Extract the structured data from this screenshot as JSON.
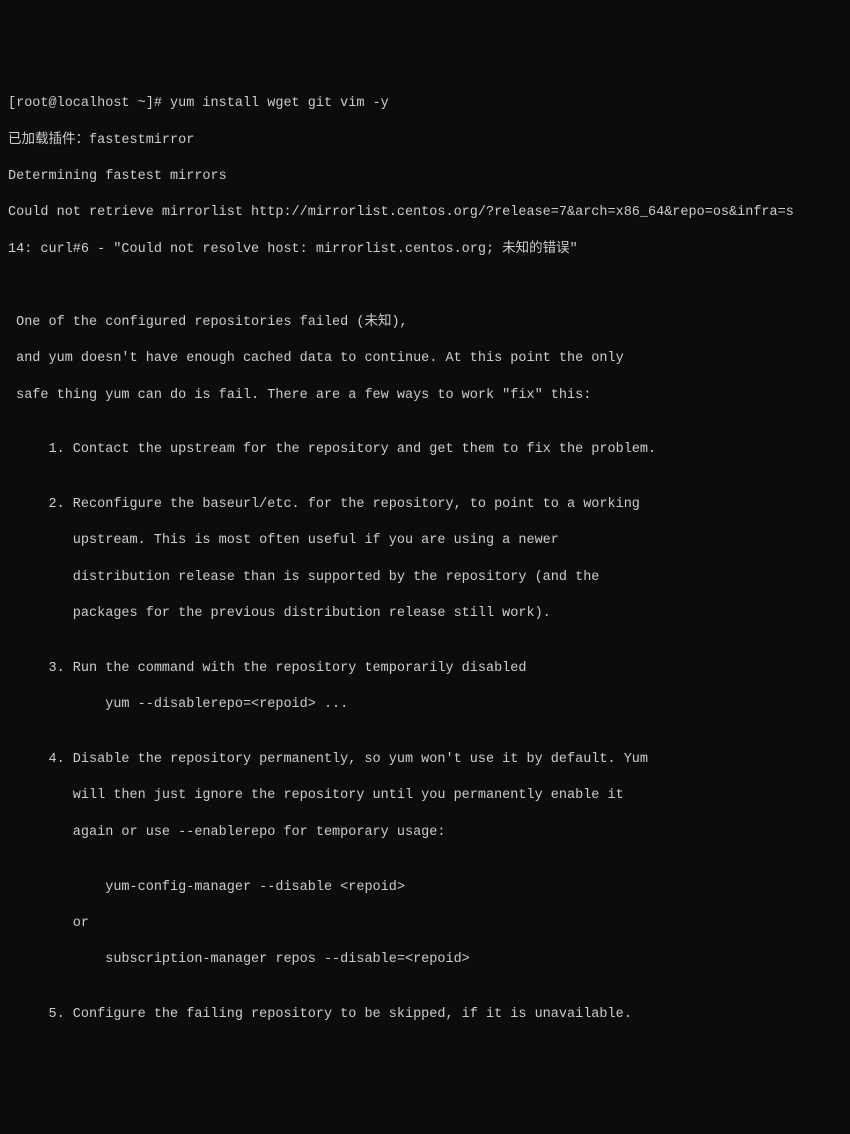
{
  "terminal": {
    "prompt": "[root@localhost ~]# ",
    "command": "yum install wget git vim -y",
    "output": {
      "line1": "已加载插件：fastestmirror",
      "line2": "Determining fastest mirrors",
      "line3": "Could not retrieve mirrorlist http://mirrorlist.centos.org/?release=7&arch=x86_64&repo=os&infra=s",
      "line4": "14: curl#6 - \"Could not resolve host: mirrorlist.centos.org; 未知的错误\"",
      "blank1": "",
      "blank2": "",
      "msg1": " One of the configured repositories failed (未知),",
      "msg2": " and yum doesn't have enough cached data to continue. At this point the only",
      "msg3": " safe thing yum can do is fail. There are a few ways to work \"fix\" this:",
      "blank3": "",
      "item1": "     1. Contact the upstream for the repository and get them to fix the problem.",
      "blank4": "",
      "item2a": "     2. Reconfigure the baseurl/etc. for the repository, to point to a working",
      "item2b": "        upstream. This is most often useful if you are using a newer",
      "item2c": "        distribution release than is supported by the repository (and the",
      "item2d": "        packages for the previous distribution release still work).",
      "blank5": "",
      "item3a": "     3. Run the command with the repository temporarily disabled",
      "item3b": "            yum --disablerepo=<repoid> ...",
      "blank6": "",
      "item4a": "     4. Disable the repository permanently, so yum won't use it by default. Yum",
      "item4b": "        will then just ignore the repository until you permanently enable it",
      "item4c": "        again or use --enablerepo for temporary usage:",
      "blank7": "",
      "item4cmd1": "            yum-config-manager --disable <repoid>",
      "item4or": "        or",
      "item4cmd2": "            subscription-manager repos --disable=<repoid>",
      "blank8": "",
      "item5": "     5. Configure the failing repository to be skipped, if it is unavailable."
    }
  }
}
